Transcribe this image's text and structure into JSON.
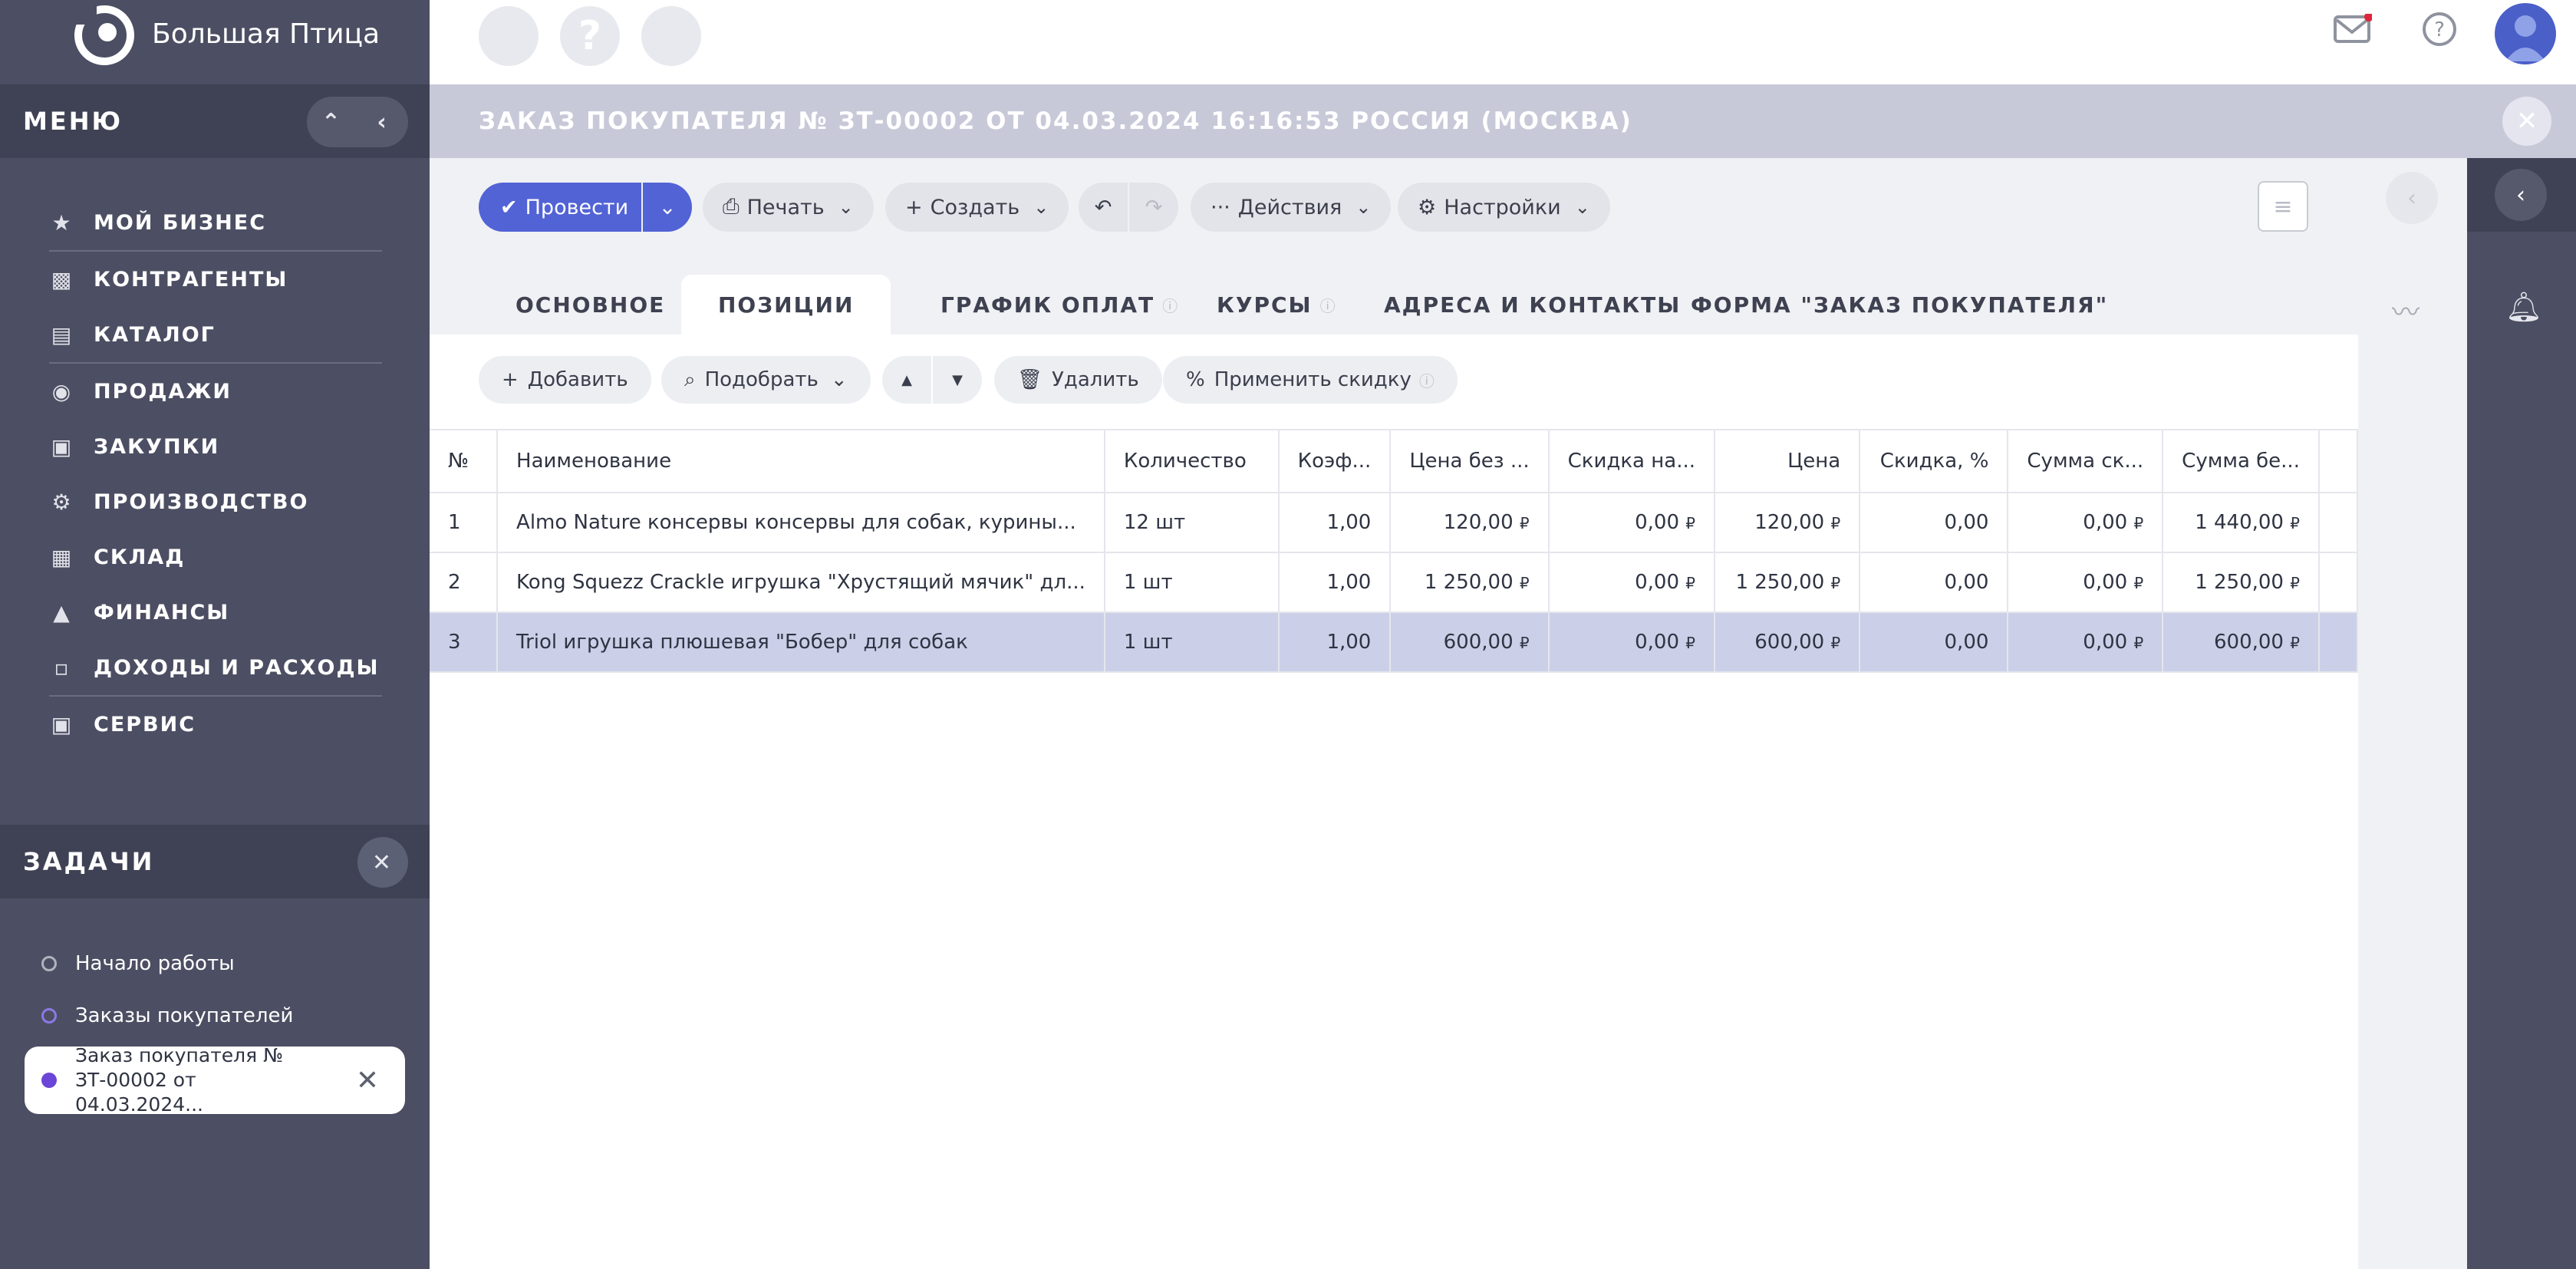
{
  "app": {
    "logo_text": "Большая Птица"
  },
  "sidebar": {
    "menu_title": "МЕНЮ",
    "menu": [
      {
        "label": "МОЙ БИЗНЕС",
        "icon": "star-icon"
      },
      {
        "label": "КОНТРАГЕНТЫ",
        "icon": "briefcase-icon"
      },
      {
        "label": "КАТАЛОГ",
        "icon": "book-icon"
      },
      {
        "label": "ПРОДАЖИ",
        "icon": "basket-icon"
      },
      {
        "label": "ЗАКУПКИ",
        "icon": "truck-icon"
      },
      {
        "label": "ПРОИЗВОДСТВО",
        "icon": "factory-icon"
      },
      {
        "label": "СКЛАД",
        "icon": "warehouse-icon"
      },
      {
        "label": "ФИНАНСЫ",
        "icon": "bank-icon"
      },
      {
        "label": "ДОХОДЫ И РАСХОДЫ",
        "icon": "wallet-icon"
      },
      {
        "label": "СЕРВИС",
        "icon": "service-icon"
      }
    ],
    "tasks_title": "ЗАДАЧИ",
    "tasks": [
      {
        "label": "Начало работы"
      },
      {
        "label": "Заказы покупателей"
      }
    ],
    "active_task_line1": "Заказ покупателя №",
    "active_task_line2": "ЗТ-00002 от 04.03.2024..."
  },
  "topbar": {
    "help_glyph": "?"
  },
  "document": {
    "title": "ЗАКАЗ ПОКУПАТЕЛЯ № ЗТ-00002 ОТ 04.03.2024 16:16:53 РОССИЯ (МОСКВА)"
  },
  "toolbar": {
    "post": "Провести",
    "print": "Печать",
    "create": "Создать",
    "actions": "Действия",
    "settings": "Настройки"
  },
  "tabs": [
    {
      "label": "ОСНОВНОЕ"
    },
    {
      "label": "ПОЗИЦИИ"
    },
    {
      "label": "ГРАФИК ОПЛАТ"
    },
    {
      "label": "КУРСЫ"
    },
    {
      "label": "АДРЕСА И КОНТАКТЫ"
    },
    {
      "label": "ФОРМА \"ЗАКАЗ ПОКУПАТЕЛЯ\""
    }
  ],
  "positions_toolbar": {
    "add": "Добавить",
    "pick": "Подобрать",
    "delete": "Удалить",
    "discount": "Применить скидку"
  },
  "table": {
    "headers": [
      "№",
      "Наименование",
      "Количество",
      "Коэф...",
      "Цена без ...",
      "Скидка на...",
      "Цена",
      "Скидка, %",
      "Сумма ск...",
      "Сумма бе..."
    ],
    "rows": [
      [
        "1",
        "Almo Nature консервы консервы для собак, курины...",
        "12 шт",
        "1,00",
        "120,00",
        "0,00",
        "120,00",
        "0,00",
        "0,00",
        "1 440,00"
      ],
      [
        "2",
        "Kong Squezz Crackle игрушка \"Хрустящий мячик\" дл...",
        "1 шт",
        "1,00",
        "1 250,00",
        "0,00",
        "1 250,00",
        "0,00",
        "0,00",
        "1 250,00"
      ],
      [
        "3",
        "Triol игрушка плюшевая \"Бобер\" для собак",
        "1 шт",
        "1,00",
        "600,00",
        "0,00",
        "600,00",
        "0,00",
        "0,00",
        "600,00"
      ]
    ],
    "currency": "₽",
    "selected_row": 3
  },
  "colors": {
    "accent": "#5263d6",
    "sidebar": "#4c4f63",
    "selected_row": "#cbcfe8",
    "notification": "#e0263a"
  }
}
